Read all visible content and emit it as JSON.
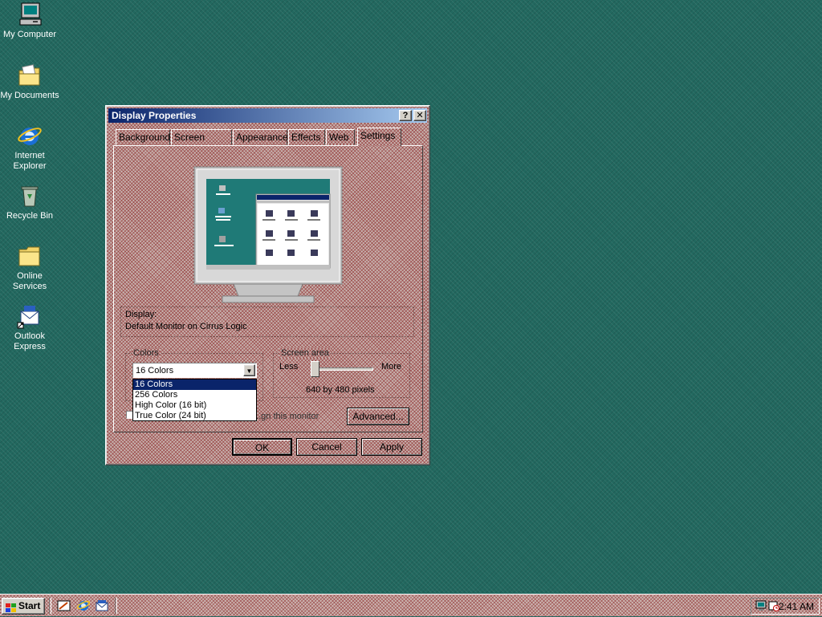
{
  "desktop": {
    "icons": [
      {
        "name": "my-computer",
        "label": "My Computer",
        "icon": "computer-icon"
      },
      {
        "name": "my-documents",
        "label": "My Documents",
        "icon": "folder-documents-icon"
      },
      {
        "name": "internet-explorer",
        "label": "Internet Explorer",
        "icon": "internet-explorer-icon"
      },
      {
        "name": "recycle-bin",
        "label": "Recycle Bin",
        "icon": "recycle-bin-icon"
      },
      {
        "name": "online-services",
        "label": "Online Services",
        "icon": "folder-icon"
      },
      {
        "name": "outlook-express",
        "label": "Outlook Express",
        "icon": "outlook-express-icon"
      }
    ]
  },
  "window": {
    "title": "Display Properties",
    "help_button": "?",
    "close_button": "✕",
    "tabs": [
      "Background",
      "Screen Saver",
      "Appearance",
      "Effects",
      "Web",
      "Settings"
    ],
    "active_tab": "Settings",
    "display_label": "Display:",
    "display_value": "Default Monitor on Cirrus Logic",
    "colors": {
      "group_label": "Colors",
      "selected": "16 Colors",
      "options": [
        "16 Colors",
        "256 Colors",
        "High Color (16 bit)",
        "True Color (24 bit)"
      ]
    },
    "screen_area": {
      "group_label": "Screen area",
      "less_label": "Less",
      "more_label": "More",
      "resolution": "640 by 480 pixels",
      "slider_position": 0
    },
    "partial_checkbox_text": "...gn this monitor",
    "advanced_button": "Advanced...",
    "ok_button": "OK",
    "cancel_button": "Cancel",
    "apply_button": "Apply"
  },
  "taskbar": {
    "start_label": "Start",
    "quick_launch": [
      "show-desktop-icon",
      "internet-explorer-icon",
      "outlook-express-icon"
    ],
    "tray_icons": [
      "display-settings-icon",
      "scheduler-icon"
    ],
    "clock": "2:41 AM"
  },
  "colors": {
    "desktop": "#22685f",
    "title_start": "#0a246a",
    "title_end": "#a6caf0",
    "selection": "#0a246a"
  }
}
